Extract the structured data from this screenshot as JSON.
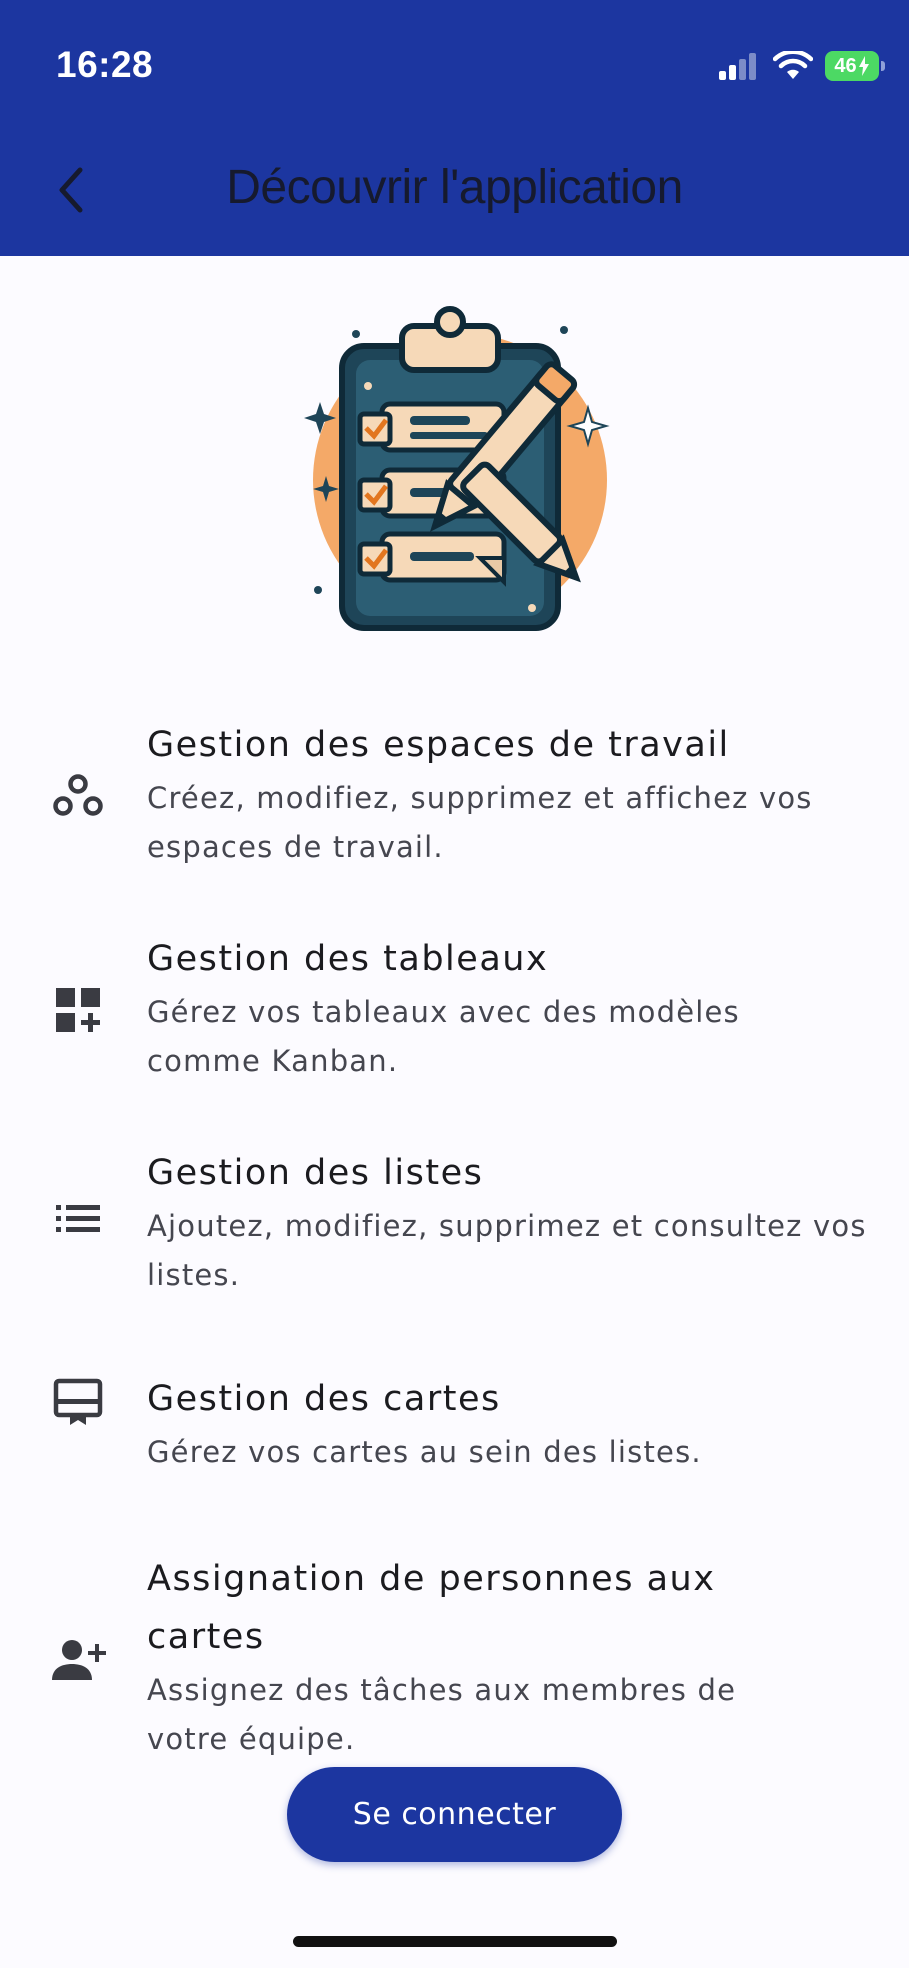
{
  "status_bar": {
    "time": "16:28",
    "battery": "46"
  },
  "header": {
    "title": "Découvrir l'application",
    "back_icon": "chevron-left-icon"
  },
  "features": [
    {
      "icon": "workspaces-icon",
      "title": "Gestion des espaces de travail",
      "description": "Créez, modifiez, supprimez et affichez vos espaces de travail."
    },
    {
      "icon": "dashboard-add-icon",
      "title": "Gestion des tableaux",
      "description": "Gérez vos tableaux avec des modèles comme Kanban."
    },
    {
      "icon": "list-icon",
      "title": "Gestion des listes",
      "description": "Ajoutez, modifiez, supprimez et consultez vos listes."
    },
    {
      "icon": "card-icon",
      "title": "Gestion des cartes",
      "description": "Gérez vos cartes au sein des listes."
    },
    {
      "icon": "person-add-icon",
      "title": "Assignation de personnes aux cartes",
      "description": "Assignez des tâches aux membres de votre équipe."
    }
  ],
  "login_button": {
    "label": "Se connecter"
  },
  "colors": {
    "primary": "#1c36a0",
    "background": "#fcfbff",
    "text": "#1b1b1f",
    "secondary_text": "#45464f",
    "illustration_orange": "#f4a968",
    "illustration_navy": "#1e4558"
  }
}
